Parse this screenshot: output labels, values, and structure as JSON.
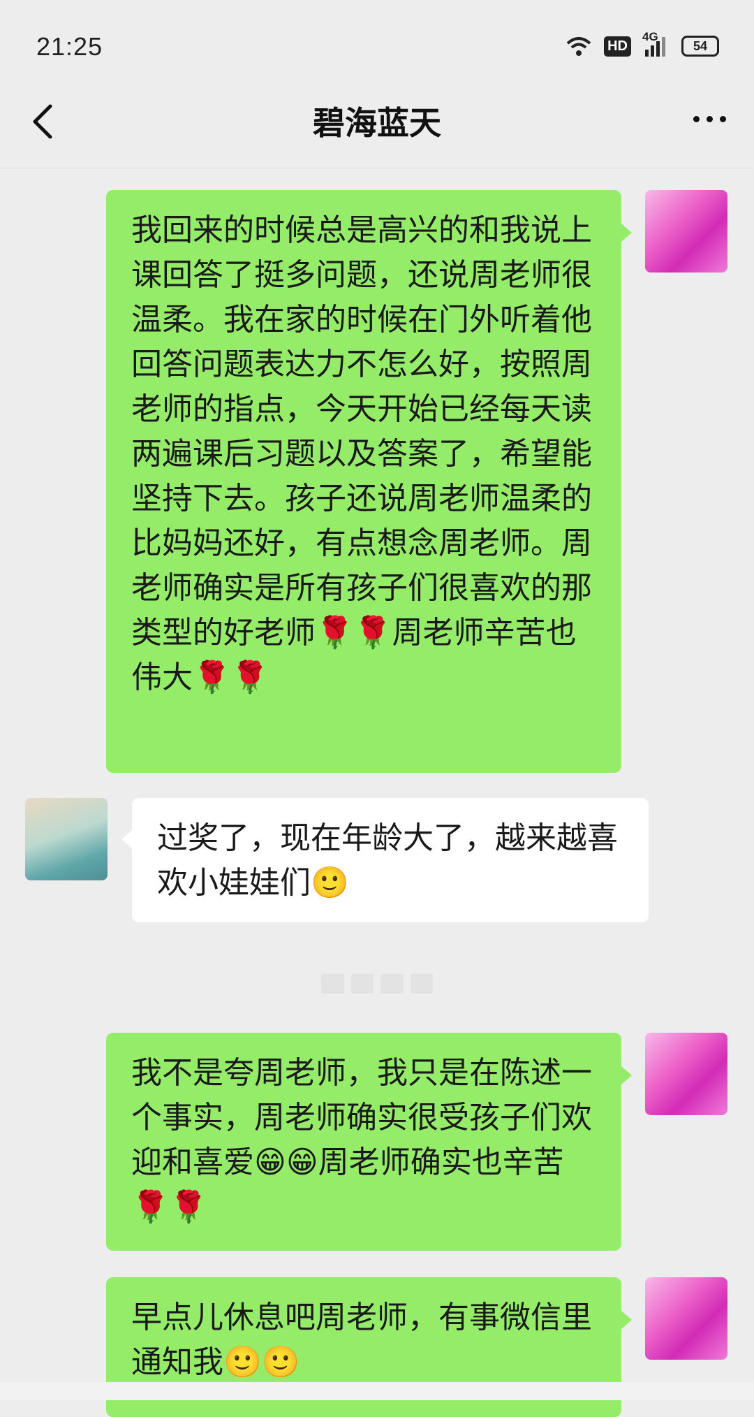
{
  "status_bar": {
    "time": "21:25",
    "battery": "54",
    "network": "4G",
    "hd_label": "HD"
  },
  "header": {
    "title": "碧海蓝天",
    "back_icon": "chevron-left-icon",
    "more_icon": "more-dots-icon"
  },
  "messages": [
    {
      "side": "self",
      "text": "我回来的时候总是高兴的和我说上课回答了挺多问题，还说周老师很温柔。我在家的时候在门外听着他回答问题表达力不怎么好，按照周老师的指点，今天开始已经每天读两遍课后习题以及答案了，希望能坚持下去。孩子还说周老师温柔的比妈妈还好，有点想念周老师。周老师确实是所有孩子们很喜欢的那类型的好老师🌹🌹周老师辛苦也伟大🌹🌹"
    },
    {
      "side": "peer",
      "text": "过奖了，现在年龄大了，越来越喜欢小娃娃们🙂"
    },
    {
      "side": "self",
      "text": "我不是夸周老师，我只是在陈述一个事实，周老师确实很受孩子们欢迎和喜爱😁😁周老师确实也辛苦🌹🌹"
    },
    {
      "side": "self",
      "text": "早点儿休息吧周老师，有事微信里通知我🙂🙂"
    }
  ]
}
